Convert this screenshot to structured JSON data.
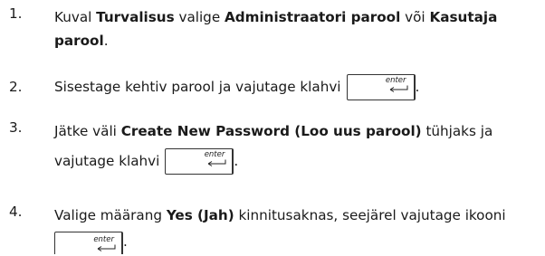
{
  "steps": [
    {
      "number": "1.",
      "parts": [
        {
          "t": "Kuval ",
          "b": false
        },
        {
          "t": "Turvalisus",
          "b": true
        },
        {
          "t": " valige ",
          "b": false
        },
        {
          "t": "Administraatori parool",
          "b": true
        },
        {
          "t": " või ",
          "b": false
        },
        {
          "t": "Kasutaja parool",
          "b": true
        },
        {
          "t": ".",
          "b": false
        }
      ]
    },
    {
      "number": "2.",
      "text_before_key": "Sisestage kehtiv parool ja vajutage klahvi",
      "text_after_key": "."
    },
    {
      "number": "3.",
      "parts": [
        {
          "t": "Jätke väli ",
          "b": false
        },
        {
          "t": "Create New Password (Loo uus parool)",
          "b": true
        },
        {
          "t": " tühjaks ja",
          "b": false
        }
      ],
      "line2_before_key": "vajutage klahvi",
      "text_after_key": "."
    },
    {
      "number": "4.",
      "parts": [
        {
          "t": "Valige määrang ",
          "b": false
        },
        {
          "t": "Yes (Jah)",
          "b": true
        },
        {
          "t": " kinnitusaknas, seejärel vajutage ikooni",
          "b": false
        }
      ],
      "text_after_key": "."
    }
  ],
  "enter_key": {
    "label": "enter",
    "icon": "enter-arrow-icon"
  }
}
